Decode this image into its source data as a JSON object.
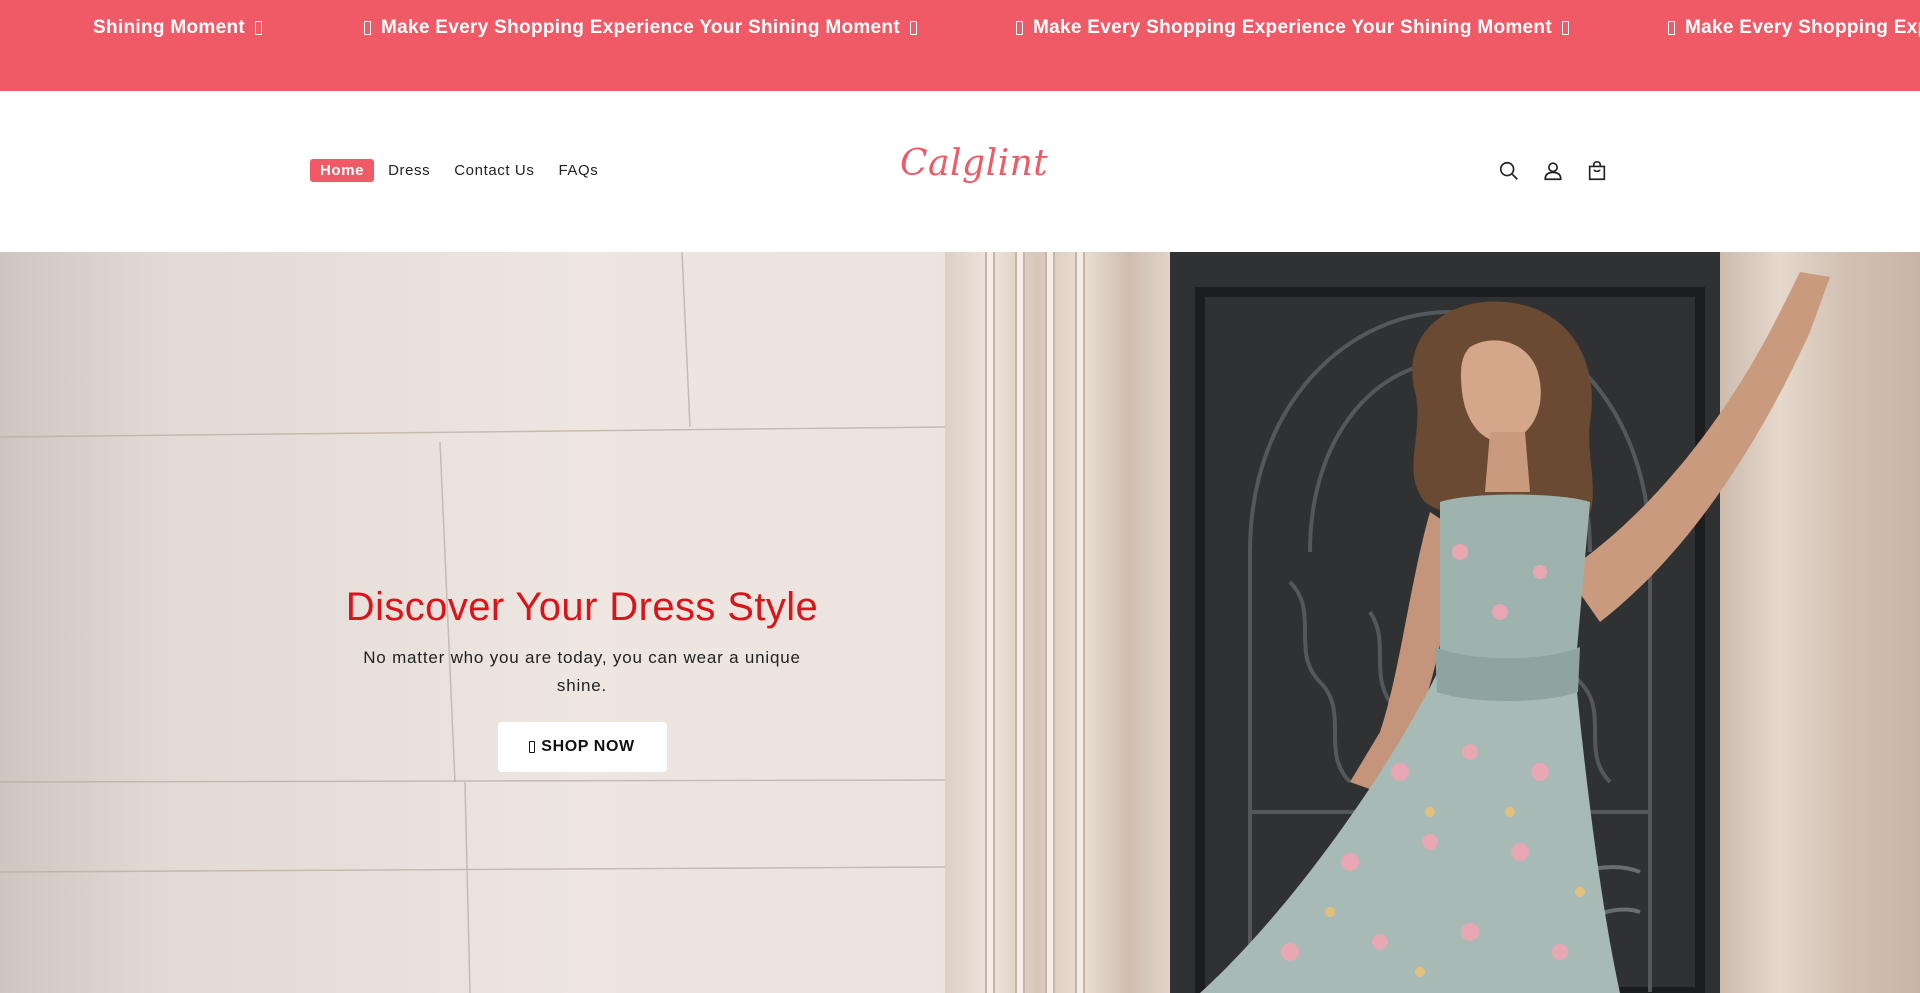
{
  "announcement": {
    "text": "Make Every Shopping Experience Your Shining Moment",
    "lead_text": "Shining Moment",
    "repeat": 3,
    "background": "#f05966",
    "icon": "sparkle-icon"
  },
  "header": {
    "nav": [
      {
        "label": "Home",
        "active": true
      },
      {
        "label": "Dress",
        "active": false
      },
      {
        "label": "Contact Us",
        "active": false
      },
      {
        "label": "FAQs",
        "active": false
      }
    ],
    "logo": "Calglint",
    "icons": [
      "search-icon",
      "account-icon",
      "cart-icon"
    ]
  },
  "hero": {
    "title": "Discover Your Dress Style",
    "subtitle": "No matter who you are today, you can wear a unique shine.",
    "cta_label": "SHOP NOW",
    "cta_icon": "bag-icon",
    "title_color": "#d9141a"
  },
  "colors": {
    "accent": "#f05966",
    "logo": "#ef5a67"
  }
}
